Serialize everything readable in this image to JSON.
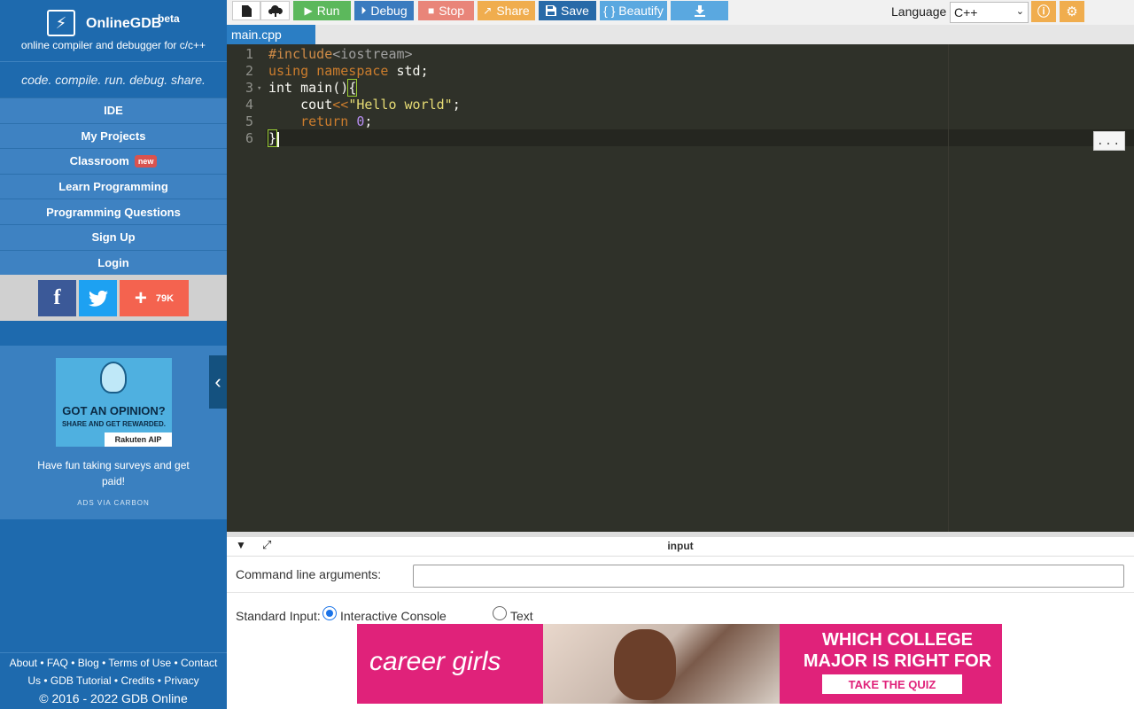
{
  "sidebar": {
    "brand_name": "OnlineGDB",
    "brand_beta": "beta",
    "brand_sub": "online compiler and debugger for c/c++",
    "tagline": "code. compile. run. debug. share.",
    "nav": [
      "IDE",
      "My Projects",
      "Classroom",
      "Learn Programming",
      "Programming Questions",
      "Sign Up",
      "Login"
    ],
    "classroom_badge": "new",
    "social": {
      "facebook": "f",
      "share_count": "79K"
    },
    "ad": {
      "headline": "GOT AN OPINION?",
      "subheadline": "SHARE AND GET REWARDED.",
      "brand": "Rakuten AIP",
      "text": "Have fun taking surveys and get paid!",
      "via": "ADS VIA CARBON"
    },
    "footer": {
      "line1": "About • FAQ • Blog • Terms of Use • Contact",
      "line2": "Us • GDB Tutorial • Credits • Privacy",
      "copyright": "© 2016 - 2022 GDB Online"
    }
  },
  "toolbar": {
    "run": "Run",
    "debug": "Debug",
    "stop": "Stop",
    "share": "Share",
    "save": "Save",
    "beautify": "{ } Beautify",
    "language_label": "Language",
    "language_value": "C++"
  },
  "tabs": {
    "active": "main.cpp"
  },
  "editor": {
    "line_numbers": [
      "1",
      "2",
      "3",
      "4",
      "5",
      "6"
    ],
    "more_label": "..."
  },
  "input_panel": {
    "title": "input",
    "args_label": "Command line arguments:",
    "args_value": "",
    "stdin_label": "Standard Input:",
    "option_interactive": "Interactive Console",
    "option_text": "Text",
    "selected": "Interactive Console"
  },
  "banner": {
    "logo": "career girls",
    "headline": "WHICH COLLEGE MAJOR IS RIGHT FOR YOU?",
    "cta": "TAKE THE QUIZ"
  },
  "colors": {
    "sidebar_bg": "#1e6aae",
    "run": "#5cb85c",
    "debug": "#3a7bbf",
    "stop": "#e98579",
    "share": "#f0ad4e",
    "editor_bg": "#2f3129"
  }
}
